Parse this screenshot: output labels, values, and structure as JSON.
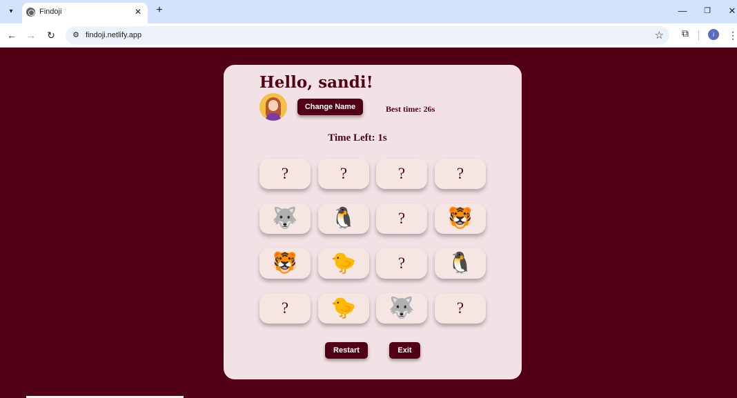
{
  "browser": {
    "tab_title": "Findoji",
    "tab_close": "✕",
    "new_tab": "+",
    "url": "findoji.netlify.app",
    "profile_initial": "i",
    "window": {
      "minimize": "—",
      "restore": "❐",
      "close": "✕"
    }
  },
  "game": {
    "greeting": "Hello, sandi!",
    "change_name_label": "Change Name",
    "best_time": "Best time: 26s",
    "time_left": "Time Left: 1s",
    "restart_label": "Restart",
    "exit_label": "Exit",
    "tiles": [
      {
        "state": "hidden",
        "text": "?"
      },
      {
        "state": "hidden",
        "text": "?"
      },
      {
        "state": "hidden",
        "text": "?"
      },
      {
        "state": "hidden",
        "text": "?"
      },
      {
        "state": "revealed",
        "text": "🐺",
        "icon": "husky"
      },
      {
        "state": "revealed",
        "text": "🐧",
        "icon": "penguin"
      },
      {
        "state": "hidden",
        "text": "?"
      },
      {
        "state": "revealed",
        "text": "🐯",
        "icon": "tiger"
      },
      {
        "state": "revealed",
        "text": "🐯",
        "icon": "tiger"
      },
      {
        "state": "revealed",
        "text": "🐤",
        "icon": "chick"
      },
      {
        "state": "hidden",
        "text": "?"
      },
      {
        "state": "revealed",
        "text": "🐧",
        "icon": "penguin"
      },
      {
        "state": "hidden",
        "text": "?"
      },
      {
        "state": "revealed",
        "text": "🐤",
        "icon": "chick"
      },
      {
        "state": "revealed",
        "text": "🐺",
        "icon": "husky"
      },
      {
        "state": "hidden",
        "text": "?"
      }
    ]
  },
  "colors": {
    "accent": "#520016",
    "card_bg": "#f2e2e5",
    "tile_bg": "#f6e6e3"
  }
}
